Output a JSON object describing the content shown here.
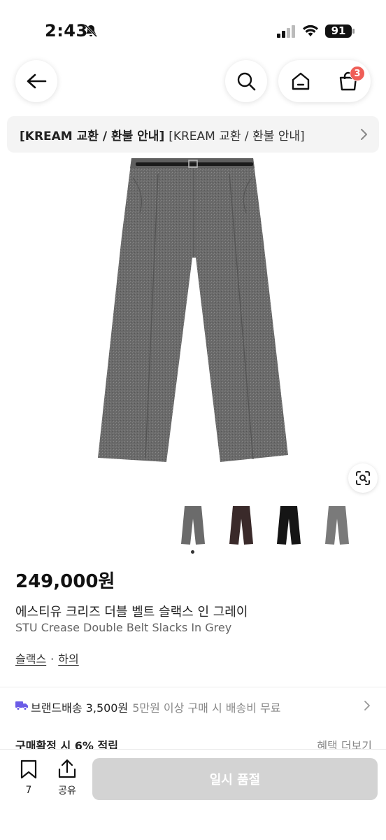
{
  "status_bar": {
    "time": "2:43",
    "battery": "91"
  },
  "header": {
    "icons": [
      "back-arrow-icon",
      "search-icon",
      "home-icon",
      "cart-icon"
    ],
    "cart_badge": "3"
  },
  "notice": {
    "strong": "[KREAM 교환 / 환불 안내]",
    "text": "[KREAM 교환 / 환불 안내]"
  },
  "product": {
    "price": "249,000원",
    "name_ko": "에스티유 크리즈 더블 벨트 슬랙스 인 그레이",
    "name_en": "STU Crease Double Belt Slacks In Grey",
    "categories": [
      "슬랙스",
      "하의"
    ],
    "category_separator": "·",
    "thumbnail_colors": [
      "#6b6b6b",
      "#3a2a2a",
      "#151515",
      "#7a7a7a"
    ],
    "selected_thumbnail": 0
  },
  "shipping": {
    "label": "브랜드배송 3,500원",
    "note": "5만원 이상 구매 시 배송비 무료"
  },
  "points": {
    "label": "구매확정 시 6% 적립",
    "more": "혜택 더보기"
  },
  "bottom_bar": {
    "bookmark_count": "7",
    "share_label": "공유",
    "buy_label": "일시 품절"
  },
  "colors": {
    "badge": "#ef5e57",
    "disabled_button": "#d3d3d3",
    "truck": "#6b5ce7"
  }
}
